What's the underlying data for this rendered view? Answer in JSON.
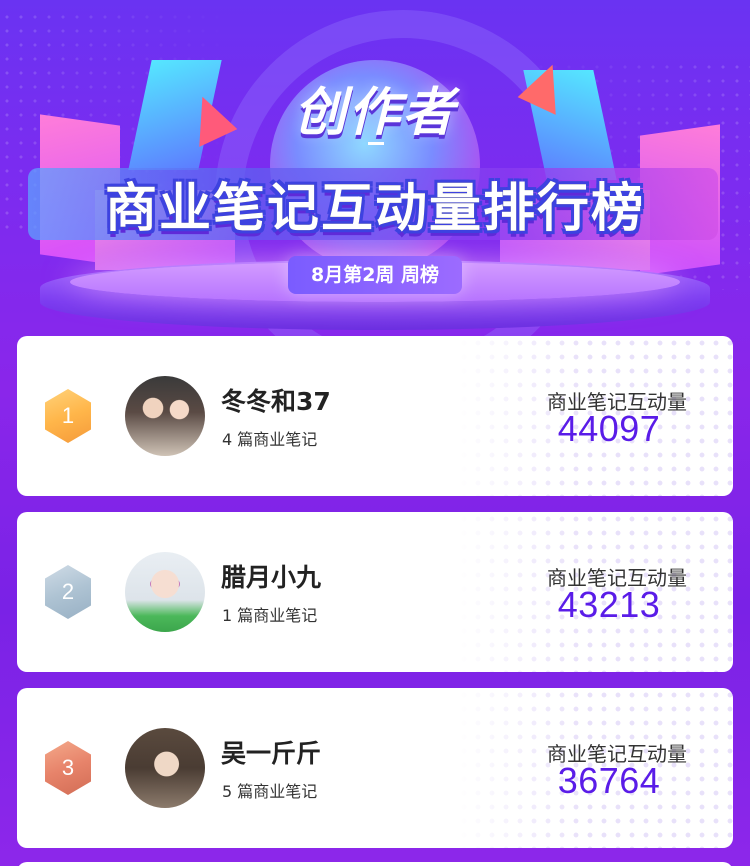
{
  "banner": {
    "title": "创作者",
    "subtitle": "商业笔记互动量排行榜",
    "period": "8月第2周 周榜"
  },
  "ranking": [
    {
      "rank": "1",
      "medal": "gold",
      "name": "冬冬和37",
      "notes": "4 篇商业笔记",
      "metric_label": "商业笔记互动量",
      "metric_value": "44097"
    },
    {
      "rank": "2",
      "medal": "silver",
      "name": "腊月小九",
      "notes": "1 篇商业笔记",
      "metric_label": "商业笔记互动量",
      "metric_value": "43213"
    },
    {
      "rank": "3",
      "medal": "bronze",
      "name": "吴一斤斤",
      "notes": "5 篇商业笔记",
      "metric_label": "商业笔记互动量",
      "metric_value": "36764"
    }
  ],
  "colors": {
    "accent": "#5a1ce8",
    "background": "#7b2cf0",
    "gold": "#ffb64a",
    "silver": "#aec3d3",
    "bronze": "#e7836a"
  },
  "icons": {
    "rank_badge": "hexagon-badge-icon"
  }
}
